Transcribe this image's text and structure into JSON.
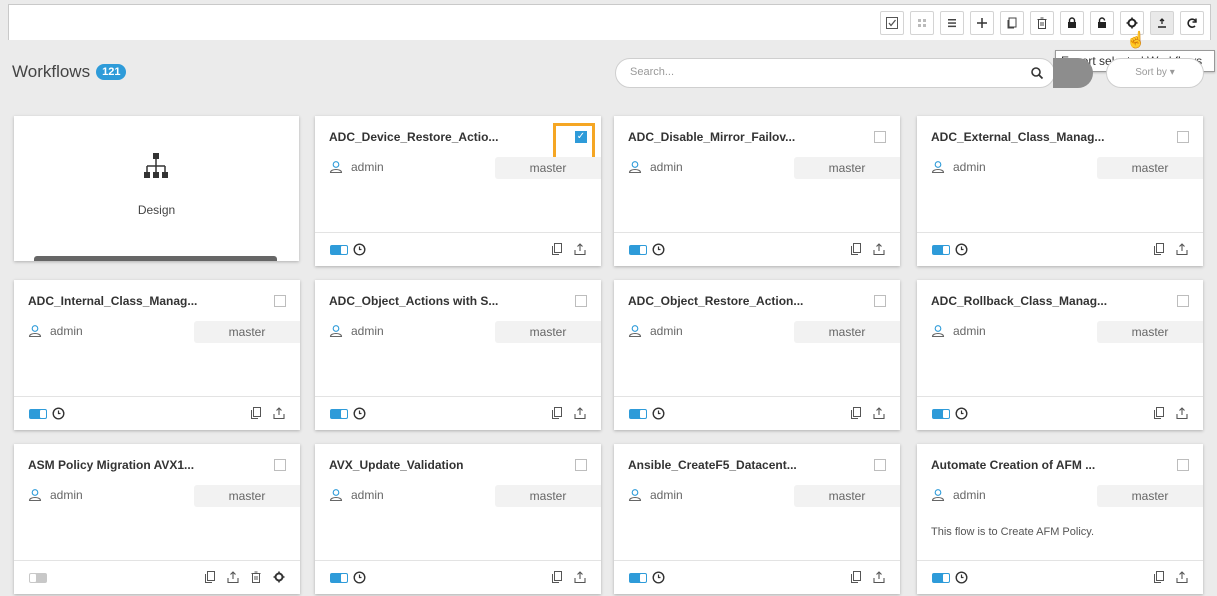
{
  "header": {
    "title": "Workflows",
    "count": "121",
    "search_placeholder": "Search...",
    "sort_label": "Sort by ▾"
  },
  "tooltip": "Export selected Workflows",
  "design_card": {
    "label": "Design"
  },
  "cards": [
    {
      "name": "ADC_Device_Restore_Actio...",
      "owner": "admin",
      "branch": "master",
      "checked": true,
      "enabled": true
    },
    {
      "name": "ADC_Disable_Mirror_Failov...",
      "owner": "admin",
      "branch": "master",
      "checked": false,
      "enabled": true
    },
    {
      "name": "ADC_External_Class_Manag...",
      "owner": "admin",
      "branch": "master",
      "checked": false,
      "enabled": true
    },
    {
      "name": "ADC_Internal_Class_Manag...",
      "owner": "admin",
      "branch": "master",
      "checked": false,
      "enabled": true
    },
    {
      "name": "ADC_Object_Actions with S...",
      "owner": "admin",
      "branch": "master",
      "checked": false,
      "enabled": true
    },
    {
      "name": "ADC_Object_Restore_Action...",
      "owner": "admin",
      "branch": "master",
      "checked": false,
      "enabled": true
    },
    {
      "name": "ADC_Rollback_Class_Manag...",
      "owner": "admin",
      "branch": "master",
      "checked": false,
      "enabled": true
    },
    {
      "name": "ASM Policy Migration AVX1...",
      "owner": "admin",
      "branch": "master",
      "checked": false,
      "enabled": false
    },
    {
      "name": "AVX_Update_Validation",
      "owner": "admin",
      "branch": "master",
      "checked": false,
      "enabled": true
    },
    {
      "name": "Ansible_CreateF5_Datacent...",
      "owner": "admin",
      "branch": "master",
      "checked": false,
      "enabled": true
    },
    {
      "name": "Automate Creation of AFM ...",
      "owner": "admin",
      "branch": "master",
      "checked": false,
      "enabled": true,
      "description": "This flow is to Create AFM Policy."
    }
  ],
  "colors": {
    "accent": "#2e9bd9",
    "highlight": "#f5a623"
  }
}
